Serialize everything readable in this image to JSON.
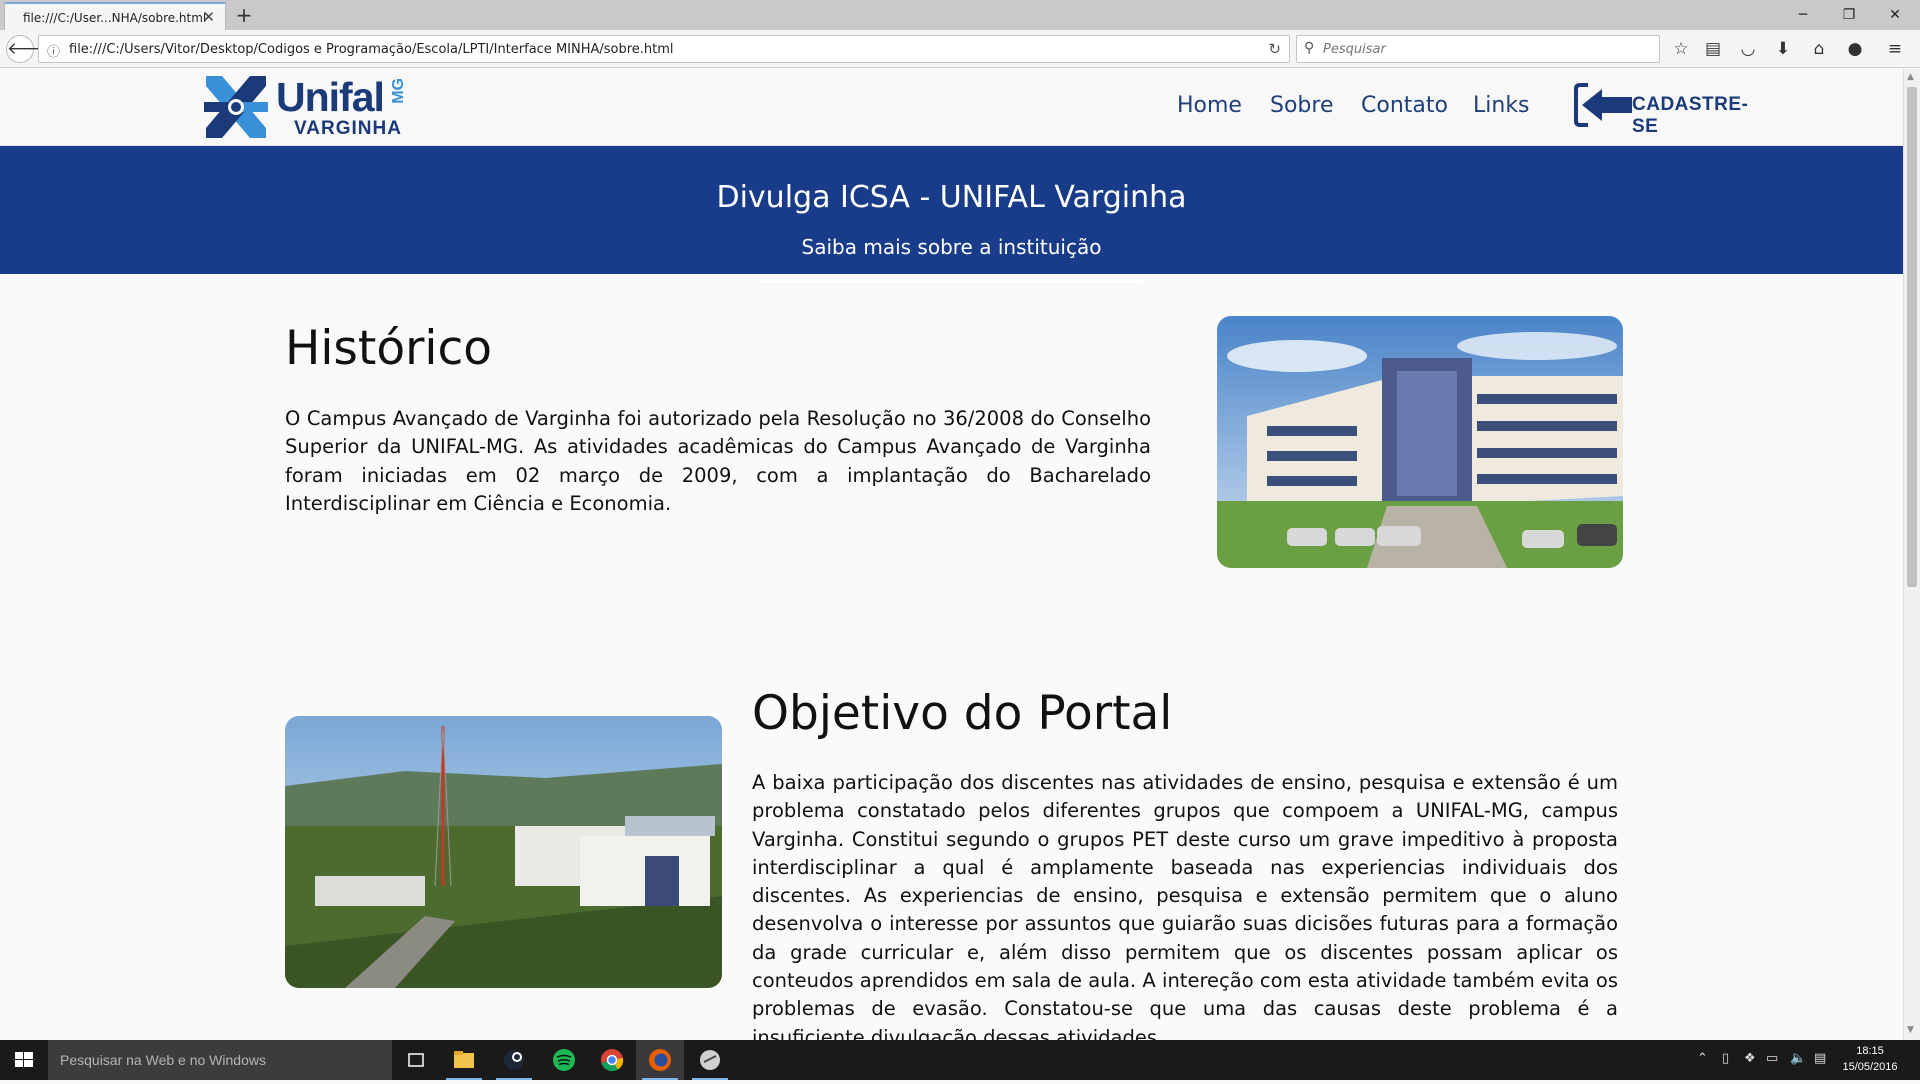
{
  "browser": {
    "tab_title": "file:///C:/User...NHA/sobre.html",
    "url": "file:///C:/Users/Vitor/Desktop/Codigos e Programação/Escola/LPTI/Interface MINHA/sobre.html",
    "search_placeholder": "Pesquisar"
  },
  "site": {
    "logo_word": "Unifal",
    "logo_mg": "MG",
    "logo_sub": "VARGINHA",
    "nav": [
      "Home",
      "Sobre",
      "Contato",
      "Links"
    ],
    "cadastre_label": "CADASTRE-SE"
  },
  "banner": {
    "title": "Divulga ICSA - UNIFAL Varginha",
    "subtitle": "Saiba mais sobre a instituição"
  },
  "historico": {
    "title": "Histórico",
    "text": "O Campus Avançado de Varginha foi autorizado pela Resolução no 36/2008 do Conselho Superior da UNIFAL-MG. As atividades acadêmicas do Campus Avançado de Varginha foram iniciadas em 02 março de 2009, com a implantação do Bacharelado Interdisciplinar em Ciência e Economia."
  },
  "objetivo": {
    "title": "Objetivo do Portal",
    "text": "A baixa participação dos discentes nas atividades de ensino, pesquisa e extensão é um problema constatado pelos diferentes grupos que compoem a UNIFAL-MG, campus Varginha. Constitui segundo o grupos PET deste curso um grave impeditivo à proposta interdisciplinar a qual é amplamente baseada nas experiencias individuais dos discentes. As experiencias de ensino, pesquisa e extensão permitem que o aluno desenvolva o interesse por assuntos que guiarão suas dicisões futuras para a formação da grade curricular e, além disso permitem que os discentes possam aplicar os conteudos aprendidos em sala de aula. A intereção com esta atividade também evita os problemas de evasão. Constatou-se que uma das causas deste problema é a insuficiente divulgação dessas atividades."
  },
  "taskbar": {
    "search_placeholder": "Pesquisar na Web e no Windows",
    "time": "18:15",
    "date": "15/05/2016"
  },
  "colors": {
    "brand_blue": "#193c8a",
    "link_blue": "#1f3e7c",
    "logo_light_blue": "#3a8fd9"
  }
}
